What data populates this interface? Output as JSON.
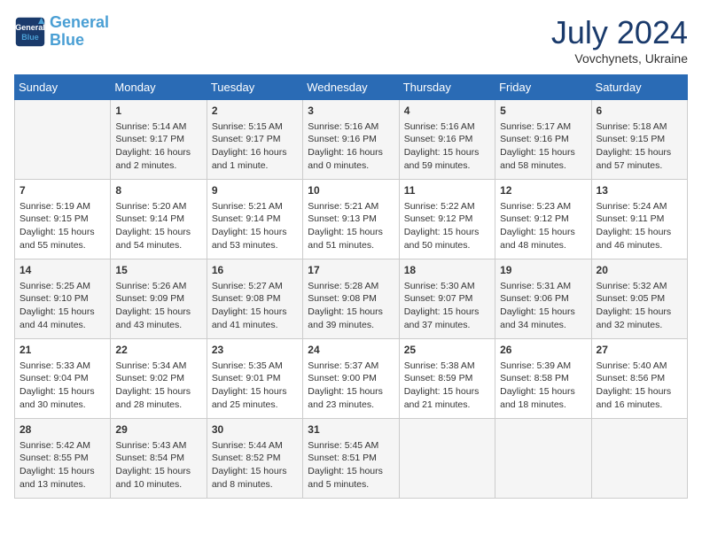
{
  "header": {
    "logo_line1": "General",
    "logo_line2": "Blue",
    "month": "July 2024",
    "location": "Vovchynets, Ukraine"
  },
  "weekdays": [
    "Sunday",
    "Monday",
    "Tuesday",
    "Wednesday",
    "Thursday",
    "Friday",
    "Saturday"
  ],
  "weeks": [
    [
      {
        "day": "",
        "info": ""
      },
      {
        "day": "1",
        "info": "Sunrise: 5:14 AM\nSunset: 9:17 PM\nDaylight: 16 hours\nand 2 minutes."
      },
      {
        "day": "2",
        "info": "Sunrise: 5:15 AM\nSunset: 9:17 PM\nDaylight: 16 hours\nand 1 minute."
      },
      {
        "day": "3",
        "info": "Sunrise: 5:16 AM\nSunset: 9:16 PM\nDaylight: 16 hours\nand 0 minutes."
      },
      {
        "day": "4",
        "info": "Sunrise: 5:16 AM\nSunset: 9:16 PM\nDaylight: 15 hours\nand 59 minutes."
      },
      {
        "day": "5",
        "info": "Sunrise: 5:17 AM\nSunset: 9:16 PM\nDaylight: 15 hours\nand 58 minutes."
      },
      {
        "day": "6",
        "info": "Sunrise: 5:18 AM\nSunset: 9:15 PM\nDaylight: 15 hours\nand 57 minutes."
      }
    ],
    [
      {
        "day": "7",
        "info": "Sunrise: 5:19 AM\nSunset: 9:15 PM\nDaylight: 15 hours\nand 55 minutes."
      },
      {
        "day": "8",
        "info": "Sunrise: 5:20 AM\nSunset: 9:14 PM\nDaylight: 15 hours\nand 54 minutes."
      },
      {
        "day": "9",
        "info": "Sunrise: 5:21 AM\nSunset: 9:14 PM\nDaylight: 15 hours\nand 53 minutes."
      },
      {
        "day": "10",
        "info": "Sunrise: 5:21 AM\nSunset: 9:13 PM\nDaylight: 15 hours\nand 51 minutes."
      },
      {
        "day": "11",
        "info": "Sunrise: 5:22 AM\nSunset: 9:12 PM\nDaylight: 15 hours\nand 50 minutes."
      },
      {
        "day": "12",
        "info": "Sunrise: 5:23 AM\nSunset: 9:12 PM\nDaylight: 15 hours\nand 48 minutes."
      },
      {
        "day": "13",
        "info": "Sunrise: 5:24 AM\nSunset: 9:11 PM\nDaylight: 15 hours\nand 46 minutes."
      }
    ],
    [
      {
        "day": "14",
        "info": "Sunrise: 5:25 AM\nSunset: 9:10 PM\nDaylight: 15 hours\nand 44 minutes."
      },
      {
        "day": "15",
        "info": "Sunrise: 5:26 AM\nSunset: 9:09 PM\nDaylight: 15 hours\nand 43 minutes."
      },
      {
        "day": "16",
        "info": "Sunrise: 5:27 AM\nSunset: 9:08 PM\nDaylight: 15 hours\nand 41 minutes."
      },
      {
        "day": "17",
        "info": "Sunrise: 5:28 AM\nSunset: 9:08 PM\nDaylight: 15 hours\nand 39 minutes."
      },
      {
        "day": "18",
        "info": "Sunrise: 5:30 AM\nSunset: 9:07 PM\nDaylight: 15 hours\nand 37 minutes."
      },
      {
        "day": "19",
        "info": "Sunrise: 5:31 AM\nSunset: 9:06 PM\nDaylight: 15 hours\nand 34 minutes."
      },
      {
        "day": "20",
        "info": "Sunrise: 5:32 AM\nSunset: 9:05 PM\nDaylight: 15 hours\nand 32 minutes."
      }
    ],
    [
      {
        "day": "21",
        "info": "Sunrise: 5:33 AM\nSunset: 9:04 PM\nDaylight: 15 hours\nand 30 minutes."
      },
      {
        "day": "22",
        "info": "Sunrise: 5:34 AM\nSunset: 9:02 PM\nDaylight: 15 hours\nand 28 minutes."
      },
      {
        "day": "23",
        "info": "Sunrise: 5:35 AM\nSunset: 9:01 PM\nDaylight: 15 hours\nand 25 minutes."
      },
      {
        "day": "24",
        "info": "Sunrise: 5:37 AM\nSunset: 9:00 PM\nDaylight: 15 hours\nand 23 minutes."
      },
      {
        "day": "25",
        "info": "Sunrise: 5:38 AM\nSunset: 8:59 PM\nDaylight: 15 hours\nand 21 minutes."
      },
      {
        "day": "26",
        "info": "Sunrise: 5:39 AM\nSunset: 8:58 PM\nDaylight: 15 hours\nand 18 minutes."
      },
      {
        "day": "27",
        "info": "Sunrise: 5:40 AM\nSunset: 8:56 PM\nDaylight: 15 hours\nand 16 minutes."
      }
    ],
    [
      {
        "day": "28",
        "info": "Sunrise: 5:42 AM\nSunset: 8:55 PM\nDaylight: 15 hours\nand 13 minutes."
      },
      {
        "day": "29",
        "info": "Sunrise: 5:43 AM\nSunset: 8:54 PM\nDaylight: 15 hours\nand 10 minutes."
      },
      {
        "day": "30",
        "info": "Sunrise: 5:44 AM\nSunset: 8:52 PM\nDaylight: 15 hours\nand 8 minutes."
      },
      {
        "day": "31",
        "info": "Sunrise: 5:45 AM\nSunset: 8:51 PM\nDaylight: 15 hours\nand 5 minutes."
      },
      {
        "day": "",
        "info": ""
      },
      {
        "day": "",
        "info": ""
      },
      {
        "day": "",
        "info": ""
      }
    ]
  ]
}
